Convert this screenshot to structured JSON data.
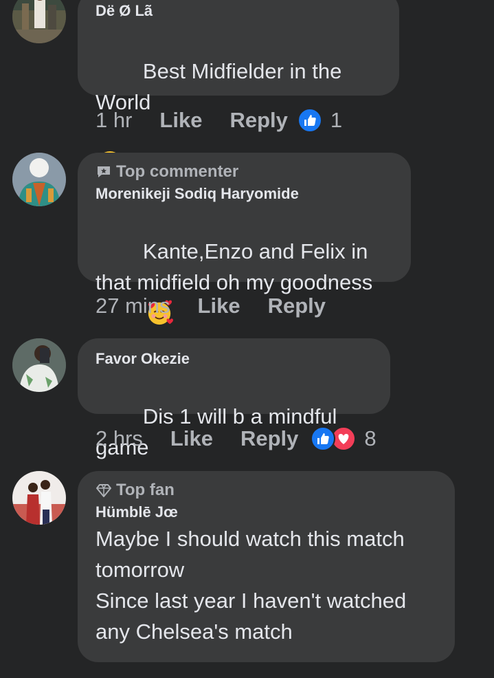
{
  "comments": [
    {
      "author": "Dë Ø Lã",
      "text": "Best Midfielder in the World",
      "badge": "",
      "time": "1 hr",
      "like": "Like",
      "reply": "Reply",
      "reactions": [
        "like"
      ],
      "reaction_count": "1"
    },
    {
      "author": "Morenikeji Sodiq Haryomide",
      "text": "Kante,Enzo and Felix in that midfield oh my goodness",
      "badge": "Top commenter",
      "time": "27 mins",
      "like": "Like",
      "reply": "Reply",
      "reactions": [],
      "reaction_count": ""
    },
    {
      "author": "Favor Okezie",
      "text": "Dis 1 will b a mindful game",
      "badge": "",
      "time": "2 hrs",
      "like": "Like",
      "reply": "Reply",
      "reactions": [
        "like",
        "love"
      ],
      "reaction_count": "8"
    },
    {
      "author": "Hümblē Jœ",
      "text": "Maybe I should watch this match tomorrow\nSince last year I haven't watched any Chelsea's match",
      "badge": "Top fan",
      "time": "",
      "like": "",
      "reply": "",
      "reactions": [],
      "reaction_count": ""
    }
  ],
  "colors": {
    "background": "#242526",
    "bubble": "#3a3b3c",
    "text": "#e4e6eb",
    "secondary": "#b0b3b8",
    "like_blue": "#1877f2",
    "love_red": "#f33e58"
  },
  "icons": {
    "emoji_row": [
      "heart-eyes-emoji",
      "white-heart-emoji",
      "blue-heart-emoji",
      "blue-heart-emoji"
    ],
    "smiling_hearts": "smiling-face-with-hearts-emoji",
    "top_commenter": "speech-bubble-star-icon",
    "top_fan": "diamond-icon"
  }
}
